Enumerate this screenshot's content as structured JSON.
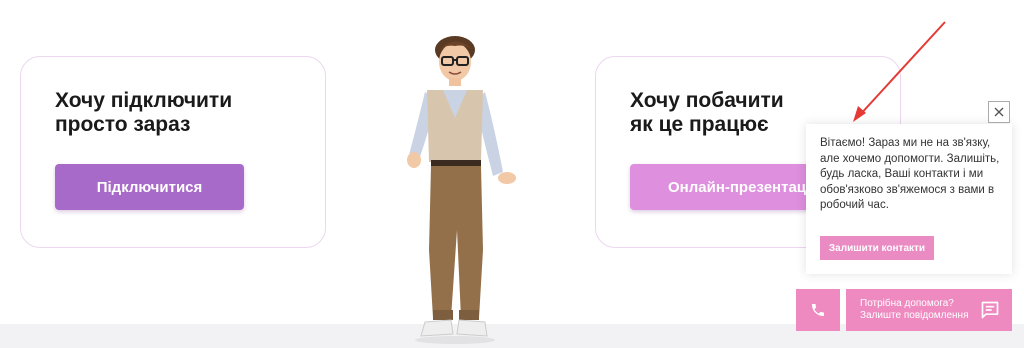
{
  "cards": {
    "left": {
      "title": "Хочу підключити\nпросто зараз",
      "button": "Підключитися"
    },
    "right": {
      "title": "Хочу побачити\nяк це працює",
      "button": "Онлайн-презентація"
    }
  },
  "chat": {
    "message": "Вітаємо! Зараз ми не на зв'язку, але хочемо допомогти. Залишіть, будь ласка, Ваші контакти і ми обов'язково зв'яжемося з вами в робочий час.",
    "cta": "Залишити контакти",
    "close_icon": "close-icon"
  },
  "help_widget": {
    "line1": "Потрібна допомога?",
    "line2": "Залиште повідомлення",
    "phone_icon": "phone-icon",
    "message_icon": "chat-bubble-icon"
  },
  "colors": {
    "connect_button": "#a86ac9",
    "demo_button": "#de8fde",
    "widget_pink": "#ee8ac0",
    "annotation_arrow": "#e53935"
  }
}
